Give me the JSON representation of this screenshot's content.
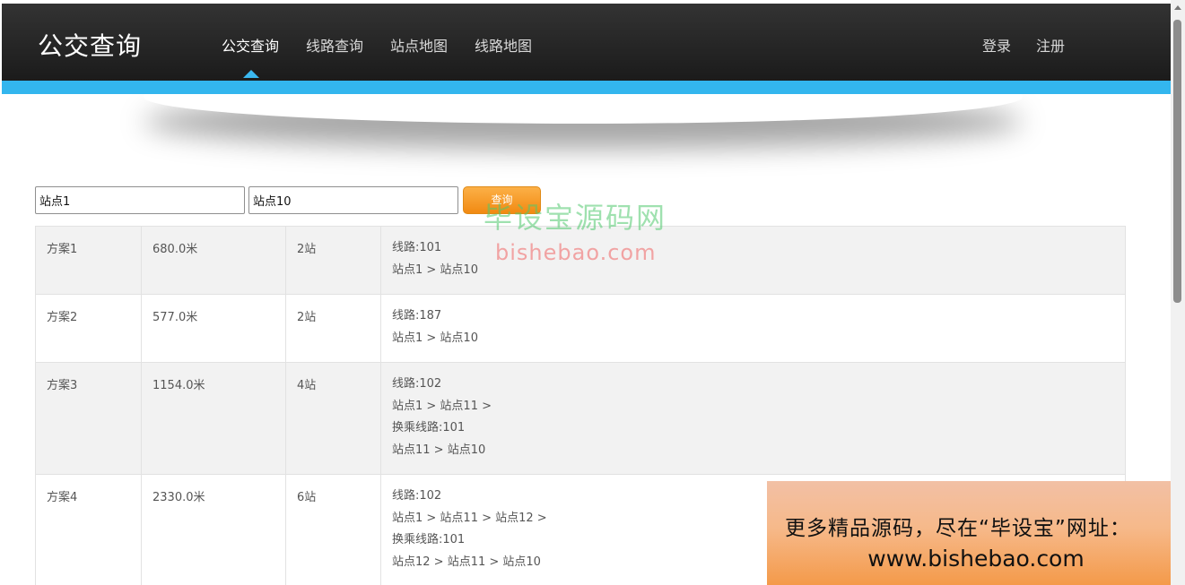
{
  "header": {
    "logo": "公交查询",
    "nav": [
      "公交查询",
      "线路查询",
      "站点地图",
      "线路地图"
    ],
    "active_nav": "公交查询",
    "right_nav": [
      "登录",
      "注册"
    ]
  },
  "search": {
    "from_value": "站点1",
    "to_value": "站点10",
    "button_label": "查询"
  },
  "results": [
    {
      "plan": "方案1",
      "distance": "680.0米",
      "stops": "2站",
      "route": [
        "线路:101",
        "站点1 > 站点10"
      ]
    },
    {
      "plan": "方案2",
      "distance": "577.0米",
      "stops": "2站",
      "route": [
        "线路:187",
        "站点1 > 站点10"
      ]
    },
    {
      "plan": "方案3",
      "distance": "1154.0米",
      "stops": "4站",
      "route": [
        "线路:102",
        "站点1 > 站点11 >",
        "换乘线路:101",
        "站点11 > 站点10"
      ]
    },
    {
      "plan": "方案4",
      "distance": "2330.0米",
      "stops": "6站",
      "route": [
        "线路:102",
        "站点1 > 站点11 > 站点12 >",
        "换乘线路:101",
        "站点12 > 站点11 > 站点10"
      ]
    }
  ],
  "watermark": {
    "line1": "毕设宝源码网",
    "line2": "bishebao.com"
  },
  "ad": {
    "line1": "更多精品源码，尽在“毕设宝”网址：",
    "line2": "www.bishebao.com"
  },
  "colors": {
    "header_bg": "#222222",
    "accent_blue": "#33b6ee",
    "button_orange": "#f18a12"
  }
}
